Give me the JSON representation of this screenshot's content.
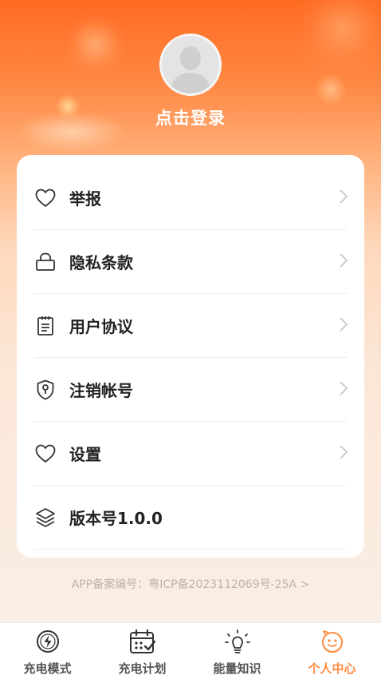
{
  "profile": {
    "login_label": "点击登录"
  },
  "menu": {
    "items": [
      {
        "label": "举报",
        "icon": "heart-icon",
        "has_chevron": true
      },
      {
        "label": "隐私条款",
        "icon": "lock-icon",
        "has_chevron": true
      },
      {
        "label": "用户协议",
        "icon": "clipboard-icon",
        "has_chevron": true
      },
      {
        "label": "注销帐号",
        "icon": "shield-key-icon",
        "has_chevron": true
      },
      {
        "label": "设置",
        "icon": "heart-icon",
        "has_chevron": true
      },
      {
        "label": "版本号1.0.0",
        "icon": "layers-icon",
        "has_chevron": false
      }
    ]
  },
  "footer": {
    "icp_text": "APP备案编号：粤ICP备2023112069号-25A >"
  },
  "tabbar": {
    "tabs": [
      {
        "label": "充电模式",
        "icon": "bolt-circle-icon",
        "active": false
      },
      {
        "label": "充电计划",
        "icon": "calendar-check-icon",
        "active": false
      },
      {
        "label": "能量知识",
        "icon": "lightbulb-icon",
        "active": false
      },
      {
        "label": "个人中心",
        "icon": "smiley-face-icon",
        "active": true
      }
    ]
  },
  "colors": {
    "accent": "#ff8a3d",
    "header_top": "#ff6a22",
    "text_primary": "#222222",
    "text_muted": "#bdb3ab"
  }
}
